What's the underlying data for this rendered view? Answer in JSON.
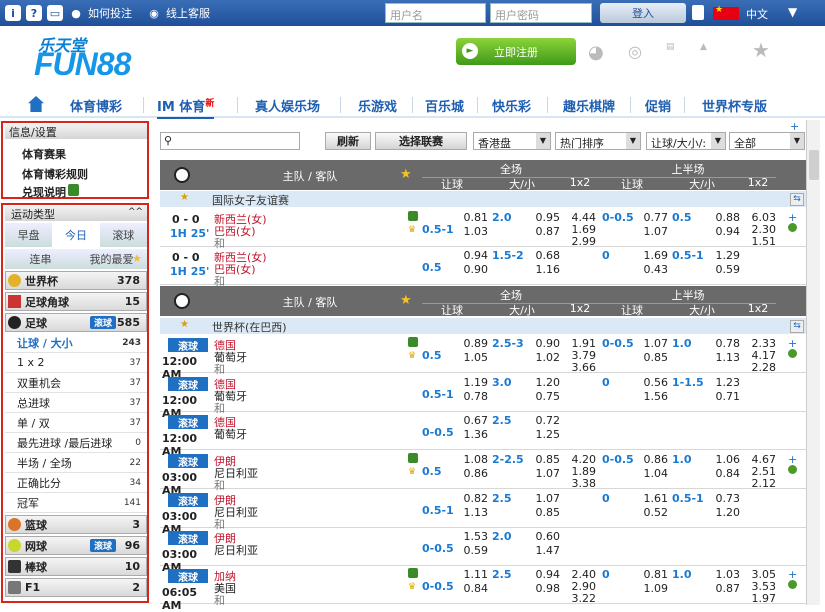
{
  "topbar": {
    "how_to_bet": "如何投注",
    "online_cs": "线上客服",
    "username_placeholder": "用户名",
    "password_placeholder": "用户密码",
    "login": "登入",
    "language": "中文"
  },
  "header": {
    "logo_cn": "乐天堂",
    "logo_en": "FUN88",
    "register": "立即注册"
  },
  "nav": {
    "items": [
      "体育博彩",
      "IM 体育",
      "真人娱乐场",
      "乐游戏",
      "百乐城",
      "快乐彩",
      "趣乐棋牌",
      "促销",
      "世界杯专版"
    ],
    "new_badge": "新"
  },
  "sidebar": {
    "info_title": "信息/设置",
    "links": [
      "体育赛果",
      "体育博彩规则",
      "兑现说明"
    ],
    "sport_type": "运动类型",
    "tabs": [
      "早盘",
      "今日",
      "滚球"
    ],
    "tabs2": [
      "连串",
      "我的最爱"
    ],
    "sports": [
      {
        "name": "世界杯",
        "count": "378"
      },
      {
        "name": "足球角球",
        "count": "15"
      },
      {
        "name": "足球",
        "count": "585",
        "live": "滚球"
      }
    ],
    "markets": [
      {
        "name": "让球 / 大小",
        "count": "243"
      },
      {
        "name": "1 x 2",
        "count": "37"
      },
      {
        "name": "双重机会",
        "count": "37"
      },
      {
        "name": "总进球",
        "count": "37"
      },
      {
        "name": "单 / 双",
        "count": "37"
      },
      {
        "name": "最先进球 /最后进球",
        "count": "0"
      },
      {
        "name": "半场 / 全场",
        "count": "22"
      },
      {
        "name": "正确比分",
        "count": "34"
      },
      {
        "name": "冠军",
        "count": "141"
      }
    ],
    "sports2": [
      {
        "name": "篮球",
        "count": "3"
      },
      {
        "name": "网球",
        "count": "96",
        "live": "滚球"
      },
      {
        "name": "棒球",
        "count": "10"
      },
      {
        "name": "F1",
        "count": "2"
      }
    ]
  },
  "filter": {
    "refresh": "刷新",
    "select_league": "选择联赛",
    "odds_type": "香港盘",
    "sort": "热门排序",
    "market": "让球/大小/:",
    "all": "全部"
  },
  "table": {
    "team_header": "主队 / 客队",
    "full": "全场",
    "half": "上半场",
    "handicap": "让球",
    "ou": "大/小",
    "x12": "1x2"
  },
  "league1": "国际女子友谊赛",
  "league2": "世界杯(在巴西)",
  "live_label": "滚球",
  "matches1": [
    {
      "score": "0 - 0",
      "time": "1H 25'",
      "home": "新西兰(女)",
      "away": "巴西(女)",
      "draw": "和",
      "hdp": "0.5-1",
      "o1": "0.81",
      "o2": "1.03",
      "ou": "2.0",
      "ou1": "0.95",
      "ou2": "0.87",
      "x1": "4.44",
      "x2": "1.69",
      "x3": "2.99",
      "hhdp": "0-0.5",
      "h1": "0.77",
      "h2": "1.07",
      "hou": "0.5",
      "hou1": "0.88",
      "hou2": "0.94",
      "hx1": "6.03",
      "hx2": "2.30",
      "hx3": "1.51"
    },
    {
      "score": "0 - 0",
      "time": "1H 25'",
      "home": "新西兰(女)",
      "away": "巴西(女)",
      "draw": "和",
      "hdp": "0.5",
      "o1": "0.94",
      "o2": "0.90",
      "ou": "1.5-2",
      "ou1": "0.68",
      "ou2": "1.16",
      "x1": "",
      "x2": "",
      "x3": "",
      "hhdp": "0",
      "h1": "1.69",
      "h2": "0.43",
      "hou": "0.5-1",
      "hou1": "1.29",
      "hou2": "0.59",
      "hx1": "",
      "hx2": "",
      "hx3": ""
    }
  ],
  "matches2": [
    {
      "time": "12:00 AM",
      "home": "德国",
      "away": "葡萄牙",
      "draw": "和",
      "hdp": "0.5",
      "o1": "0.89",
      "o2": "1.05",
      "ou": "2.5-3",
      "ou1": "0.90",
      "ou2": "1.02",
      "x1": "1.91",
      "x2": "3.79",
      "x3": "3.66",
      "hhdp": "0-0.5",
      "h1": "1.07",
      "h2": "0.85",
      "hou": "1.0",
      "hou1": "0.78",
      "hou2": "1.13",
      "hx1": "2.33",
      "hx2": "4.17",
      "hx3": "2.28"
    },
    {
      "time": "12:00 AM",
      "home": "德国",
      "away": "葡萄牙",
      "draw": "和",
      "hdp": "0.5-1",
      "o1": "1.19",
      "o2": "0.78",
      "ou": "3.0",
      "ou1": "1.20",
      "ou2": "0.75",
      "x1": "",
      "x2": "",
      "x3": "",
      "hhdp": "0",
      "h1": "0.56",
      "h2": "1.56",
      "hou": "1-1.5",
      "hou1": "1.23",
      "hou2": "0.71",
      "hx1": "",
      "hx2": "",
      "hx3": ""
    },
    {
      "time": "12:00 AM",
      "home": "德国",
      "away": "葡萄牙",
      "draw": "",
      "hdp": "0-0.5",
      "o1": "0.67",
      "o2": "1.36",
      "ou": "2.5",
      "ou1": "0.72",
      "ou2": "1.25",
      "x1": "",
      "x2": "",
      "x3": "",
      "hhdp": "",
      "h1": "",
      "h2": "",
      "hou": "",
      "hou1": "",
      "hou2": "",
      "hx1": "",
      "hx2": "",
      "hx3": ""
    },
    {
      "time": "03:00 AM",
      "home": "伊朗",
      "away": "尼日利亚",
      "draw": "和",
      "hdp": "0.5",
      "o1": "1.08",
      "o2": "0.86",
      "ou": "2-2.5",
      "ou1": "0.85",
      "ou2": "1.07",
      "x1": "4.20",
      "x2": "1.89",
      "x3": "3.38",
      "hhdp": "0-0.5",
      "h1": "0.86",
      "h2": "1.04",
      "hou": "1.0",
      "hou1": "1.06",
      "hou2": "0.84",
      "hx1": "4.67",
      "hx2": "2.51",
      "hx3": "2.12"
    },
    {
      "time": "03:00 AM",
      "home": "伊朗",
      "away": "尼日利亚",
      "draw": "和",
      "hdp": "0.5-1",
      "o1": "0.82",
      "o2": "1.13",
      "ou": "2.5",
      "ou1": "1.07",
      "ou2": "0.85",
      "x1": "",
      "x2": "",
      "x3": "",
      "hhdp": "0",
      "h1": "1.61",
      "h2": "0.52",
      "hou": "0.5-1",
      "hou1": "0.73",
      "hou2": "1.20",
      "hx1": "",
      "hx2": "",
      "hx3": ""
    },
    {
      "time": "03:00 AM",
      "home": "伊朗",
      "away": "尼日利亚",
      "draw": "",
      "hdp": "0-0.5",
      "o1": "1.53",
      "o2": "0.59",
      "ou": "2.0",
      "ou1": "0.60",
      "ou2": "1.47",
      "x1": "",
      "x2": "",
      "x3": "",
      "hhdp": "",
      "h1": "",
      "h2": "",
      "hou": "",
      "hou1": "",
      "hou2": "",
      "hx1": "",
      "hx2": "",
      "hx3": ""
    },
    {
      "time": "06:05 AM",
      "home": "加纳",
      "away": "美国",
      "draw": "和",
      "hdp": "0-0.5",
      "o1": "1.11",
      "o2": "0.84",
      "ou": "2.5",
      "ou1": "0.94",
      "ou2": "0.98",
      "x1": "2.40",
      "x2": "2.90",
      "x3": "3.22",
      "hhdp": "0",
      "h1": "0.81",
      "h2": "1.09",
      "hou": "1.0",
      "hou1": "1.03",
      "hou2": "0.87",
      "hx1": "3.05",
      "hx2": "3.53",
      "hx3": "1.97"
    }
  ]
}
